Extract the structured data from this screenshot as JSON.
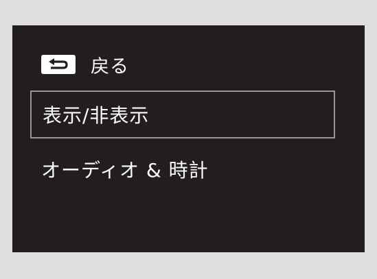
{
  "colors": {
    "page_background": "#dededd",
    "screen_background": "#221e1e",
    "text": "#ffffff",
    "selection_border": "#9a9797"
  },
  "back": {
    "icon": "return-arrow-icon",
    "label": "戻る"
  },
  "menu": {
    "selected_index": 0,
    "items": [
      {
        "label": "表示/非表示"
      },
      {
        "label": "オーディオ & 時計"
      }
    ]
  }
}
